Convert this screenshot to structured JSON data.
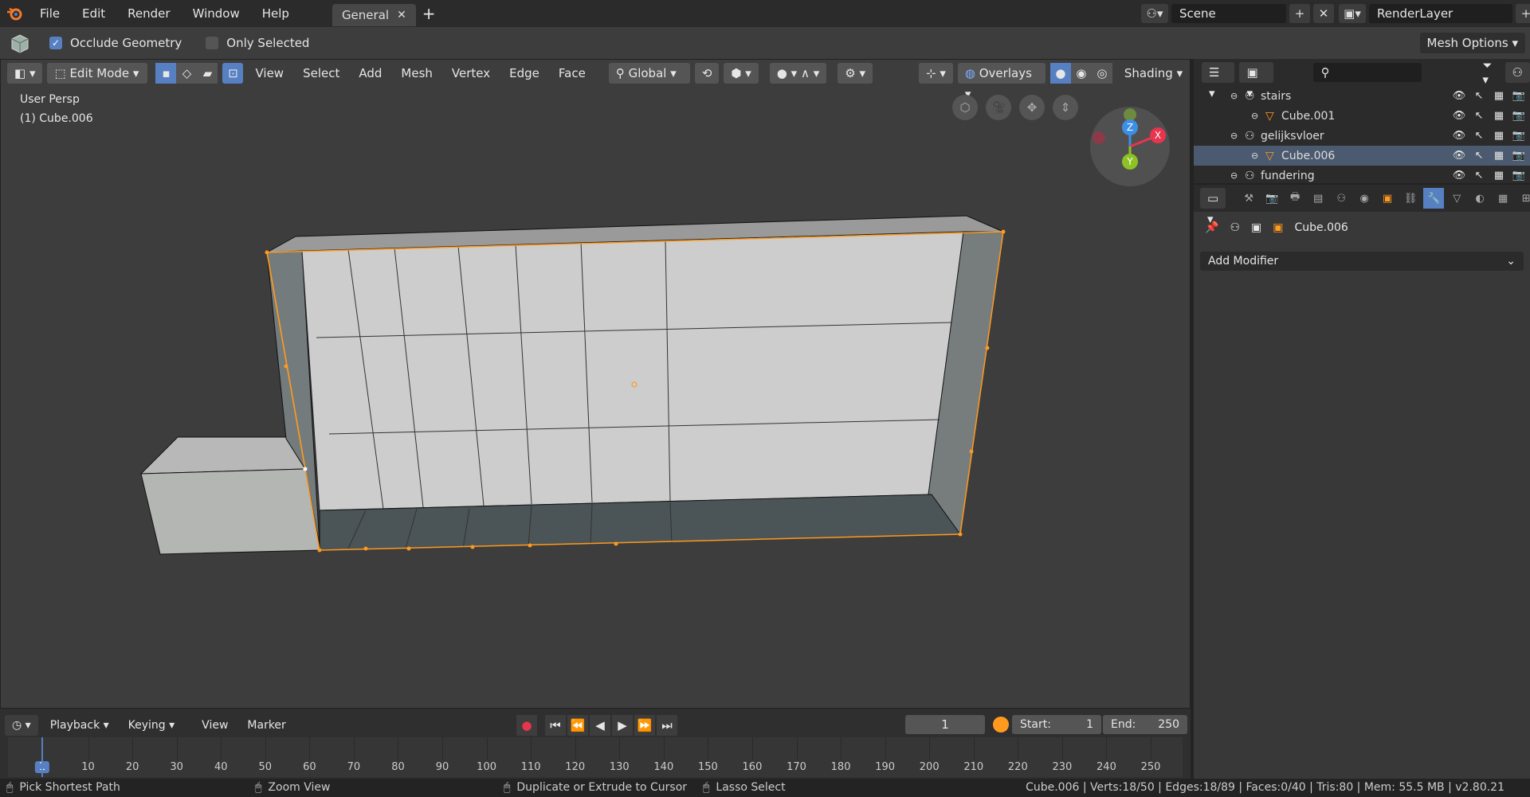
{
  "menu": [
    "File",
    "Edit",
    "Render",
    "Window",
    "Help"
  ],
  "workspace_tab": "General",
  "scene": "Scene",
  "render_layer": "RenderLayer",
  "tool_settings": {
    "occlude_label": "Occlude Geometry",
    "only_selected_label": "Only Selected",
    "mesh_options": "Mesh Options",
    "occlude_checked": true,
    "only_selected_checked": false
  },
  "viewport_header": {
    "mode": "Edit Mode",
    "menus": [
      "View",
      "Select",
      "Add",
      "Mesh",
      "Vertex",
      "Edge",
      "Face"
    ],
    "orientation": "Global",
    "overlays": "Overlays",
    "shading": "Shading"
  },
  "viewport": {
    "view_label": "User Persp",
    "object_label": "(1) Cube.006"
  },
  "gizmo": {
    "x": "X",
    "y": "Y",
    "z": "Z"
  },
  "outliner": {
    "rows": [
      {
        "name": "stairs",
        "type": "collection"
      },
      {
        "name": "Cube.001",
        "type": "mesh"
      },
      {
        "name": "gelijksvloer",
        "type": "collection"
      },
      {
        "name": "Cube.006",
        "type": "mesh",
        "selected": true
      },
      {
        "name": "fundering",
        "type": "collection"
      }
    ]
  },
  "properties": {
    "object_name": "Cube.006",
    "add_modifier": "Add Modifier"
  },
  "timeline": {
    "menus": [
      "Playback",
      "Keying",
      "View",
      "Marker"
    ],
    "current_frame": "1",
    "start_label": "Start:",
    "start": "1",
    "end_label": "End:",
    "end": "250",
    "ticks": [
      "1",
      "10",
      "20",
      "30",
      "40",
      "50",
      "60",
      "70",
      "80",
      "90",
      "100",
      "110",
      "120",
      "130",
      "140",
      "150",
      "160",
      "170",
      "180",
      "190",
      "200",
      "210",
      "220",
      "230",
      "240",
      "250"
    ]
  },
  "status": {
    "hints": [
      "Pick Shortest Path",
      "Zoom View",
      "Duplicate or Extrude to Cursor",
      "Lasso Select"
    ],
    "info": "Cube.006 | Verts:18/50 | Edges:18/89 | Faces:0/40 | Tris:80 | Mem: 55.5 MB | v2.80.21"
  },
  "colors": {
    "accent": "#5680c2",
    "selection": "#ff9a1f",
    "axis_x": "#e8344e",
    "axis_y": "#8cc224",
    "axis_z": "#3b8fe6"
  }
}
